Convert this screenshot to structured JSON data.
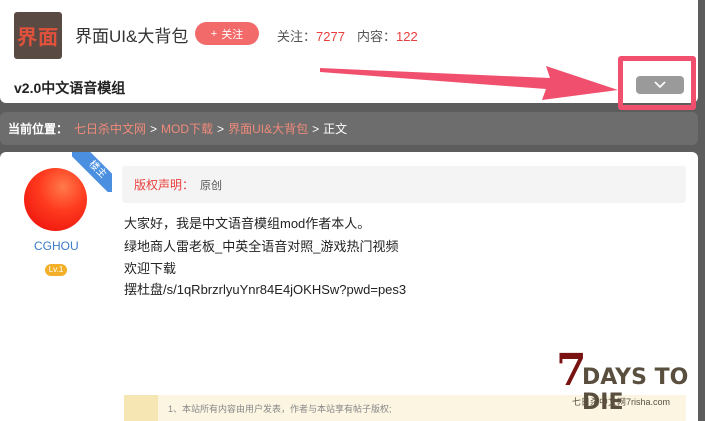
{
  "header": {
    "logo_text": "界面",
    "forum_name": "界面UI&大背包",
    "follow_label": "关注",
    "follow_icon": "+",
    "stats": {
      "follow_label": "关注：",
      "follow_count": "7277",
      "content_label": "内容：",
      "content_count": "122"
    },
    "thread_title": "v2.0中文语音模组"
  },
  "breadcrumb": {
    "label": "当前位置：",
    "items": [
      "七日杀中文网",
      "MOD下载",
      "界面UI&大背包"
    ],
    "separator": ">",
    "current": "正文"
  },
  "post": {
    "ribbon": "楼主",
    "author": "CGHOU",
    "level": "Lv.1",
    "copyright_key": "版权声明：",
    "copyright_value": "原创",
    "lines": [
      "大家好，我是中文语音模组mod作者本人。",
      "绿地商人雷老板_中英全语音对照_游戏热门视频",
      "欢迎下载",
      "摆杜盘/s/1qRbrzrlyuYnr84E4jOKHSw?pwd=pes3"
    ],
    "notice": "1、本站所有内容由用户发表，作者与本站享有帖子版权;"
  },
  "watermark": {
    "big": "7",
    "title": "DAYS TO DIE",
    "sub": "七日杀中文网7risha.com"
  },
  "icons": {
    "expand": "chevron-down-icon",
    "arrow": "red-arrow-annotation"
  },
  "colors": {
    "accent": "#e8403e",
    "follow_button": "#f26a6a",
    "annotation": "#f0506e",
    "link": "#3b7bc8"
  }
}
